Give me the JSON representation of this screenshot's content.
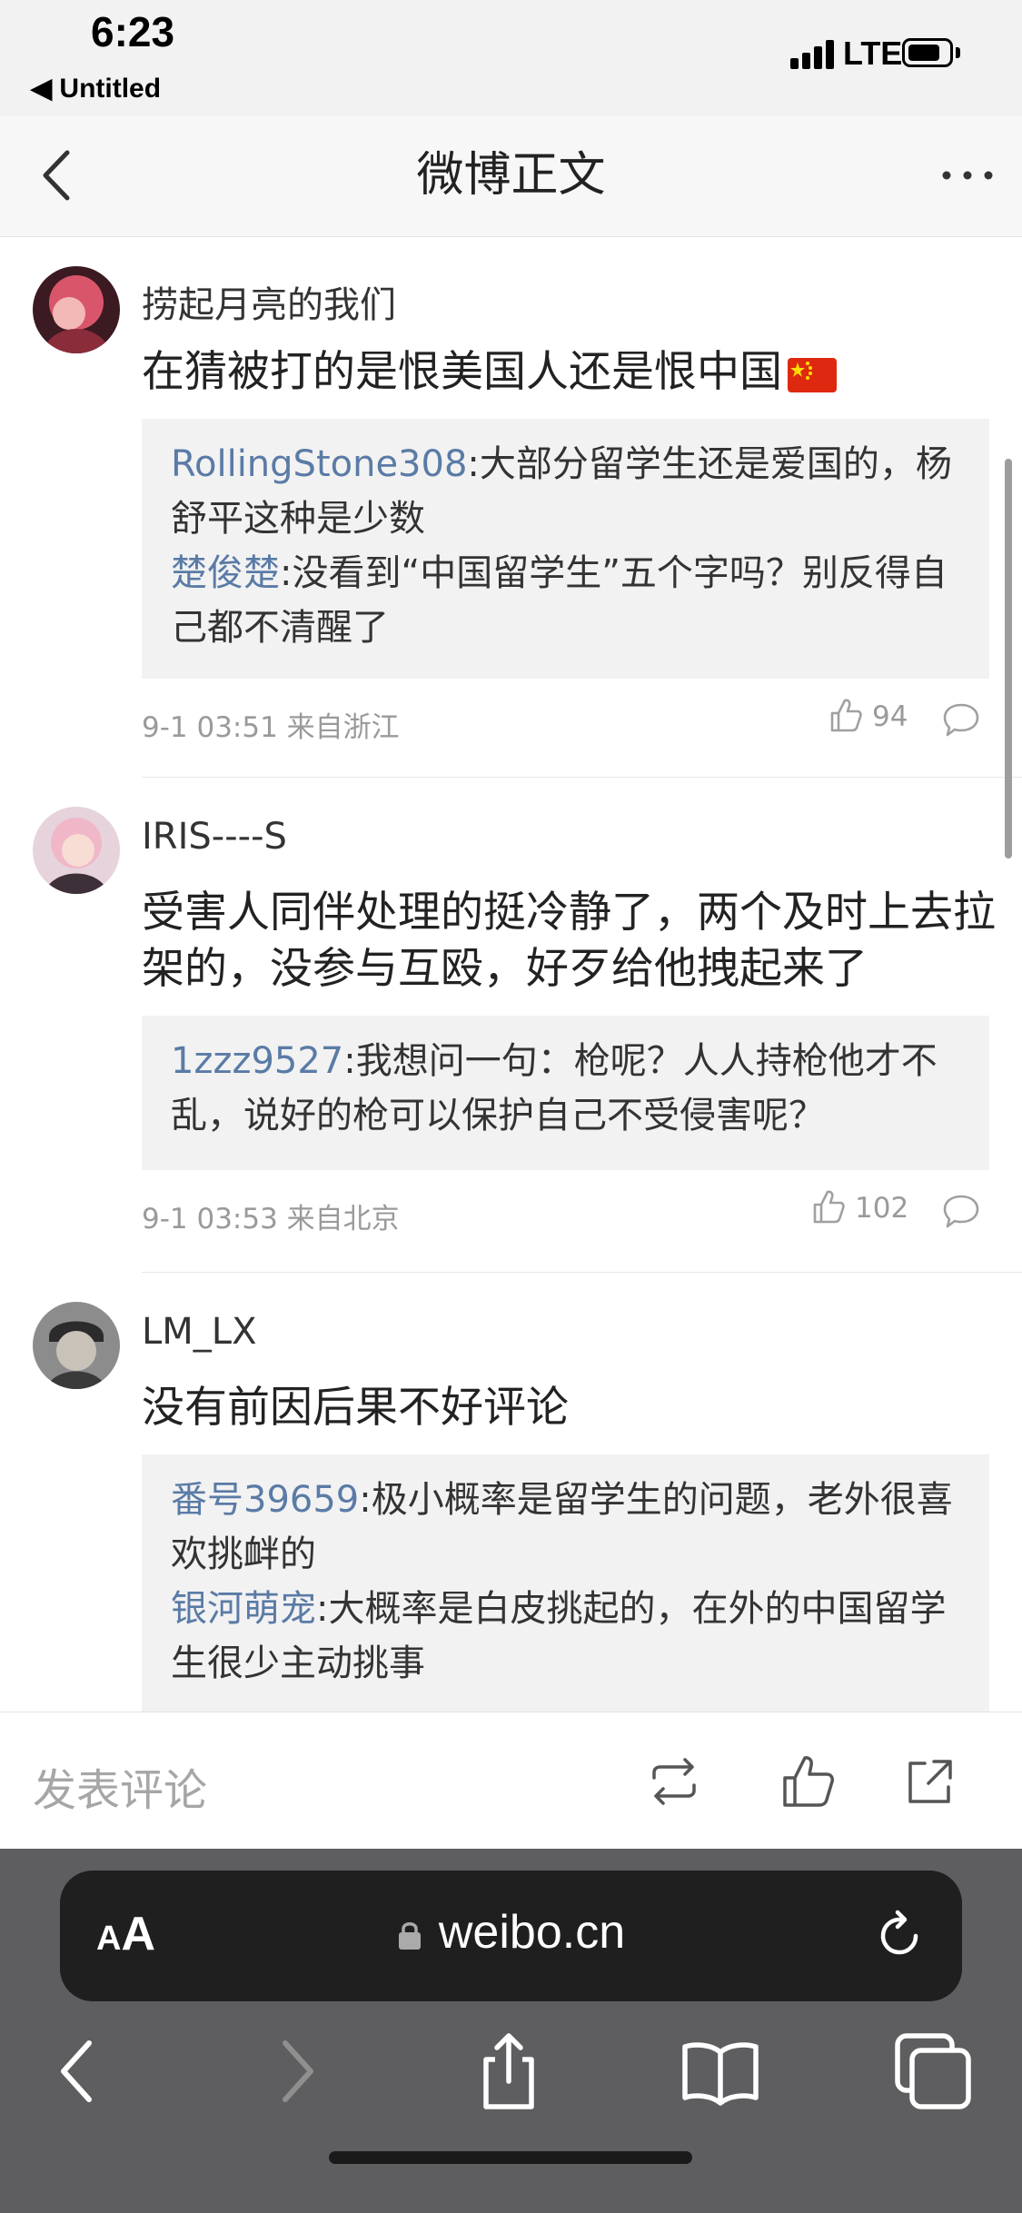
{
  "status_bar": {
    "time": "6:23",
    "back_app": "◀ Untitled",
    "network": "LTE"
  },
  "nav": {
    "title": "微博正文"
  },
  "comments": [
    {
      "username": "捞起月亮的我们",
      "text": "在猜被打的是恨美国人还是恨中国",
      "replies": [
        {
          "name": "RollingStone308",
          "text": ":大部分留学生还是爱国的，杨舒平这种是少数"
        },
        {
          "name": "楚俊楚",
          "text": ":没看到“中国留学生”五个字吗？别反得自己都不清醒了"
        }
      ],
      "time": "9-1 03:51 来自浙江",
      "likes": "94"
    },
    {
      "username": "IRIS----S",
      "text": "受害人同伴处理的挺冷静了，两个及时上去拉架的，没参与互殴，好歹给他拽起来了",
      "replies": [
        {
          "name": "1zzz9527",
          "text": ":我想问一句：枪呢？人人持枪他才不乱，说好的枪可以保护自己不受侵害呢？"
        }
      ],
      "time": "9-1 03:53 来自北京",
      "likes": "102"
    },
    {
      "username": "LM_LX",
      "text": "没有前因后果不好评论",
      "replies": [
        {
          "name": "番号39659",
          "text": ":极小概率是留学生的问题，老外很喜欢挑衅的"
        },
        {
          "name": "银河萌宠",
          "text": ":大概率是白皮挑起的，在外的中国留学生很少主动挑事"
        }
      ]
    }
  ],
  "compose": {
    "placeholder": "发表评论"
  },
  "safari": {
    "aa_small": "A",
    "aa_big": "A",
    "url": "weibo.cn"
  },
  "colors": {
    "reply_name": "#5a7ba6",
    "meta": "#9a9a9a",
    "reply_bg": "#f2f2f2"
  },
  "icons": [
    "back-icon",
    "more-icon",
    "like-icon",
    "comment-icon",
    "repost-icon",
    "thumbs-up-icon",
    "share-icon",
    "lock-icon",
    "reload-icon",
    "safari-back-icon",
    "safari-forward-icon",
    "safari-share-icon",
    "bookmarks-icon",
    "tabs-icon"
  ]
}
